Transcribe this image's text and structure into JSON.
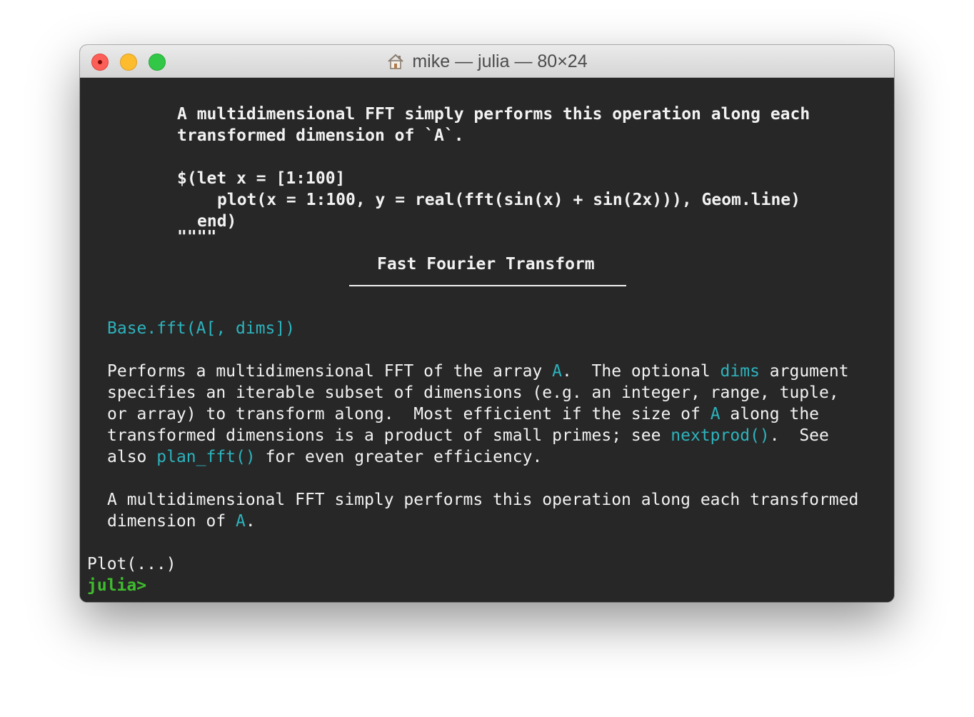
{
  "window": {
    "title": "mike — julia — 80×24"
  },
  "icons": {
    "close": "close-icon",
    "minimize": "minimize-icon",
    "maximize": "maximize-icon",
    "home": "house-icon"
  },
  "colors": {
    "background": "#272727",
    "text": "#f2f2f2",
    "link": "#2db3bd",
    "prompt": "#3fbc2e"
  },
  "terminal": {
    "raw": {
      "line1": "A multidimensional FFT simply performs this operation along each",
      "line2": "transformed dimension of `A`.",
      "line3": "$(let x = [1:100]",
      "line4": "plot(x = 1:100, y = real(fft(sin(x) + sin(2x))), Geom.line)",
      "line5": "end)",
      "line6": "\"\"\"\""
    },
    "heading": "Fast Fourier Transform",
    "signature": "Base.fft(A[, dims])",
    "para1": {
      "l1_a": "Performs a multidimensional FFT of the array ",
      "l1_b": "A",
      "l1_c": ".  The optional ",
      "l1_d": "dims",
      "l1_e": " argument",
      "l2": "specifies an iterable subset of dimensions (e.g. an integer, range, tuple,",
      "l3_a": "or array) to transform along.  Most efficient if the size of ",
      "l3_b": "A",
      "l3_c": " along the",
      "l4_a": "transformed dimensions is a product of small primes; see ",
      "l4_b": "nextprod()",
      "l4_c": ".  See",
      "l5_a": "also ",
      "l5_b": "plan_fft()",
      "l5_c": " for even greater efficiency."
    },
    "para2": {
      "l1": "A multidimensional FFT simply performs this operation along each transformed",
      "l2_a": "dimension of ",
      "l2_b": "A",
      "l2_c": "."
    },
    "output": "Plot(...)",
    "prompt": "julia>"
  }
}
